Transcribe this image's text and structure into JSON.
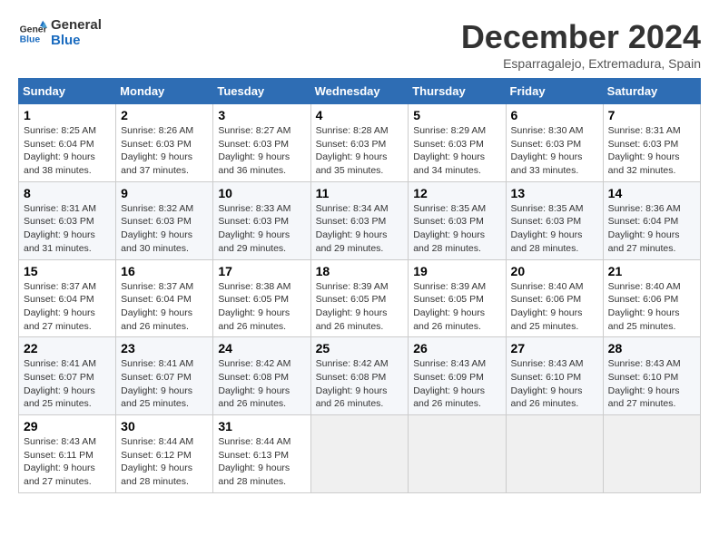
{
  "logo": {
    "line1": "General",
    "line2": "Blue"
  },
  "title": "December 2024",
  "subtitle": "Esparragalejo, Extremadura, Spain",
  "days_of_week": [
    "Sunday",
    "Monday",
    "Tuesday",
    "Wednesday",
    "Thursday",
    "Friday",
    "Saturday"
  ],
  "weeks": [
    [
      {
        "day": "1",
        "info": "Sunrise: 8:25 AM\nSunset: 6:04 PM\nDaylight: 9 hours\nand 38 minutes."
      },
      {
        "day": "2",
        "info": "Sunrise: 8:26 AM\nSunset: 6:03 PM\nDaylight: 9 hours\nand 37 minutes."
      },
      {
        "day": "3",
        "info": "Sunrise: 8:27 AM\nSunset: 6:03 PM\nDaylight: 9 hours\nand 36 minutes."
      },
      {
        "day": "4",
        "info": "Sunrise: 8:28 AM\nSunset: 6:03 PM\nDaylight: 9 hours\nand 35 minutes."
      },
      {
        "day": "5",
        "info": "Sunrise: 8:29 AM\nSunset: 6:03 PM\nDaylight: 9 hours\nand 34 minutes."
      },
      {
        "day": "6",
        "info": "Sunrise: 8:30 AM\nSunset: 6:03 PM\nDaylight: 9 hours\nand 33 minutes."
      },
      {
        "day": "7",
        "info": "Sunrise: 8:31 AM\nSunset: 6:03 PM\nDaylight: 9 hours\nand 32 minutes."
      }
    ],
    [
      {
        "day": "8",
        "info": "Sunrise: 8:31 AM\nSunset: 6:03 PM\nDaylight: 9 hours\nand 31 minutes."
      },
      {
        "day": "9",
        "info": "Sunrise: 8:32 AM\nSunset: 6:03 PM\nDaylight: 9 hours\nand 30 minutes."
      },
      {
        "day": "10",
        "info": "Sunrise: 8:33 AM\nSunset: 6:03 PM\nDaylight: 9 hours\nand 29 minutes."
      },
      {
        "day": "11",
        "info": "Sunrise: 8:34 AM\nSunset: 6:03 PM\nDaylight: 9 hours\nand 29 minutes."
      },
      {
        "day": "12",
        "info": "Sunrise: 8:35 AM\nSunset: 6:03 PM\nDaylight: 9 hours\nand 28 minutes."
      },
      {
        "day": "13",
        "info": "Sunrise: 8:35 AM\nSunset: 6:03 PM\nDaylight: 9 hours\nand 28 minutes."
      },
      {
        "day": "14",
        "info": "Sunrise: 8:36 AM\nSunset: 6:04 PM\nDaylight: 9 hours\nand 27 minutes."
      }
    ],
    [
      {
        "day": "15",
        "info": "Sunrise: 8:37 AM\nSunset: 6:04 PM\nDaylight: 9 hours\nand 27 minutes."
      },
      {
        "day": "16",
        "info": "Sunrise: 8:37 AM\nSunset: 6:04 PM\nDaylight: 9 hours\nand 26 minutes."
      },
      {
        "day": "17",
        "info": "Sunrise: 8:38 AM\nSunset: 6:05 PM\nDaylight: 9 hours\nand 26 minutes."
      },
      {
        "day": "18",
        "info": "Sunrise: 8:39 AM\nSunset: 6:05 PM\nDaylight: 9 hours\nand 26 minutes."
      },
      {
        "day": "19",
        "info": "Sunrise: 8:39 AM\nSunset: 6:05 PM\nDaylight: 9 hours\nand 26 minutes."
      },
      {
        "day": "20",
        "info": "Sunrise: 8:40 AM\nSunset: 6:06 PM\nDaylight: 9 hours\nand 25 minutes."
      },
      {
        "day": "21",
        "info": "Sunrise: 8:40 AM\nSunset: 6:06 PM\nDaylight: 9 hours\nand 25 minutes."
      }
    ],
    [
      {
        "day": "22",
        "info": "Sunrise: 8:41 AM\nSunset: 6:07 PM\nDaylight: 9 hours\nand 25 minutes."
      },
      {
        "day": "23",
        "info": "Sunrise: 8:41 AM\nSunset: 6:07 PM\nDaylight: 9 hours\nand 25 minutes."
      },
      {
        "day": "24",
        "info": "Sunrise: 8:42 AM\nSunset: 6:08 PM\nDaylight: 9 hours\nand 26 minutes."
      },
      {
        "day": "25",
        "info": "Sunrise: 8:42 AM\nSunset: 6:08 PM\nDaylight: 9 hours\nand 26 minutes."
      },
      {
        "day": "26",
        "info": "Sunrise: 8:43 AM\nSunset: 6:09 PM\nDaylight: 9 hours\nand 26 minutes."
      },
      {
        "day": "27",
        "info": "Sunrise: 8:43 AM\nSunset: 6:10 PM\nDaylight: 9 hours\nand 26 minutes."
      },
      {
        "day": "28",
        "info": "Sunrise: 8:43 AM\nSunset: 6:10 PM\nDaylight: 9 hours\nand 27 minutes."
      }
    ],
    [
      {
        "day": "29",
        "info": "Sunrise: 8:43 AM\nSunset: 6:11 PM\nDaylight: 9 hours\nand 27 minutes."
      },
      {
        "day": "30",
        "info": "Sunrise: 8:44 AM\nSunset: 6:12 PM\nDaylight: 9 hours\nand 28 minutes."
      },
      {
        "day": "31",
        "info": "Sunrise: 8:44 AM\nSunset: 6:13 PM\nDaylight: 9 hours\nand 28 minutes."
      },
      {
        "day": "",
        "info": ""
      },
      {
        "day": "",
        "info": ""
      },
      {
        "day": "",
        "info": ""
      },
      {
        "day": "",
        "info": ""
      }
    ]
  ]
}
